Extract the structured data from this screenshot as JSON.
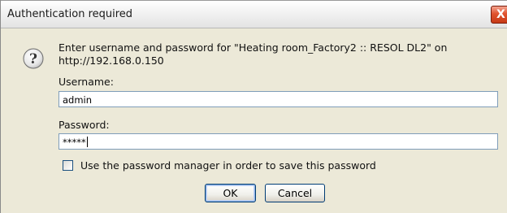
{
  "dialog": {
    "title": "Authentication required",
    "close_symbol": "X",
    "message": "Enter username and password for \"Heating room_Factory2 :: RESOL DL2\" on http://192.168.0.150",
    "username": {
      "label": "Username:",
      "value": "admin"
    },
    "password": {
      "label": "Password:",
      "value": "*****"
    },
    "remember": {
      "label": "Use the password manager in order to save this password",
      "checked": false
    },
    "buttons": {
      "ok_label": "OK",
      "cancel_label": "Cancel"
    },
    "icons": {
      "prompt": "question-icon",
      "close": "close-icon"
    },
    "colors": {
      "close_button": "#d9482a",
      "field_border": "#7f9db9",
      "dialog_bg": "#ece9d8"
    }
  }
}
